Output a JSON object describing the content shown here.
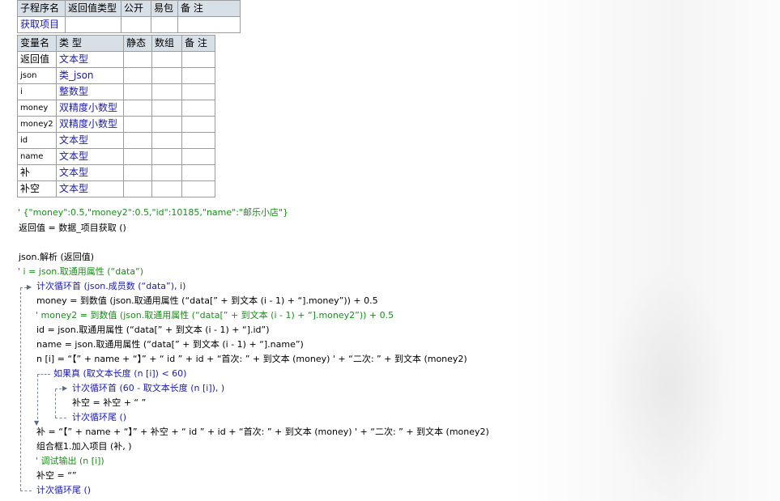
{
  "sub_table": {
    "headers": [
      "子程序名",
      "返回值类型",
      "公开",
      "易包",
      "备 注"
    ],
    "row": [
      "获取项目",
      "",
      "",
      "",
      ""
    ]
  },
  "var_table": {
    "headers": [
      "变量名",
      "类 型",
      "静态",
      "数组",
      "备 注"
    ],
    "rows": [
      [
        "返回值",
        "文本型"
      ],
      [
        "json",
        "类_json"
      ],
      [
        "i",
        "整数型"
      ],
      [
        "money",
        "双精度小数型"
      ],
      [
        "money2",
        "双精度小数型"
      ],
      [
        "id",
        "文本型"
      ],
      [
        "name",
        "文本型"
      ],
      [
        "补",
        "文本型"
      ],
      [
        "补空",
        "文本型"
      ]
    ]
  },
  "code": {
    "l1": "' {\"money\":0.5,\"money2\":0.5,\"id\":10185,\"name\":\"邮乐小店\"}",
    "l2": "返回值 = 数据_项目获取 ()",
    "l3": "json.解析 (返回值)",
    "l4": "' i = json.取通用属性 (“data”)",
    "l5": "计次循环首 (json.成员数 (“data”), i)",
    "l6": "money = 到数值 (json.取通用属性 (“data[” + 到文本 (i - 1) + “].money”)) + 0.5",
    "l7": "' money2 = 到数值 (json.取通用属性 (“data[” + 到文本 (i - 1) + “].money2”)) + 0.5",
    "l8": "id = json.取通用属性 (“data[” + 到文本 (i - 1) + “].id”)",
    "l9": "name = json.取通用属性 (“data[” + 到文本 (i - 1) + “].name”)",
    "l10": "n [i] = “【” + name + “】” + “ id ” + id + “首次: ” + 到文本 (money) ' + “二次: ” + 到文本 (money2)",
    "l11": "如果真 (取文本长度 (n [i]) < 60)",
    "l12": "计次循环首 (60 - 取文本长度 (n [i]), )",
    "l13": "补空 = 补空 + “ ”",
    "l14": "计次循环尾 ()",
    "l15": "补 = “【” + name + “】” + 补空 + “ id ” + id + “首次: ” + 到文本 (money) ' + “二次: ” + 到文本 (money2)",
    "l16": "组合框1.加入项目 (补, )",
    "l17": "' 调试输出 (n [i])",
    "l18": "补空 = “”",
    "l19": "计次循环尾 ()"
  },
  "colors": {
    "header_bg": "#d7dfe7",
    "type_text": "#1a1ab0",
    "comment": "#1a8c1a",
    "command": "#8b1a1a"
  }
}
